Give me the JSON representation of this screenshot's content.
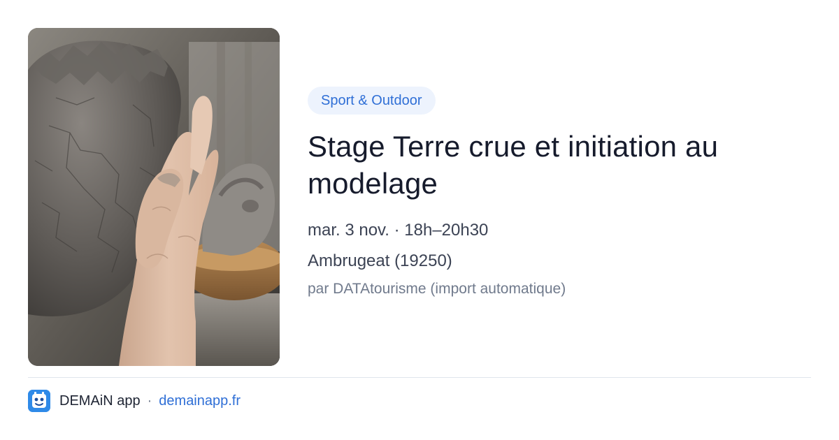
{
  "event": {
    "category": "Sport & Outdoor",
    "title": "Stage Terre crue et initiation au modelage",
    "datetime": "mar. 3 nov. · 18h–20h30",
    "location": "Ambrugeat (19250)",
    "source": "par DATAtourisme (import automatique)",
    "image_subject": "hand-holding-raw-clay-photo"
  },
  "footer": {
    "app_name": "DEMAiN app",
    "separator": "·",
    "domain": "demainapp.fr",
    "logo_icon": "demain-app-logo-icon"
  },
  "colors": {
    "accent": "#2f6fd6",
    "badge_bg": "#edf3fd",
    "title": "#161b2c",
    "secondary_text": "#3c4354",
    "muted_text": "#707a8c",
    "divider": "#dfe5ec",
    "logo_bg": "#2f8ae8"
  }
}
